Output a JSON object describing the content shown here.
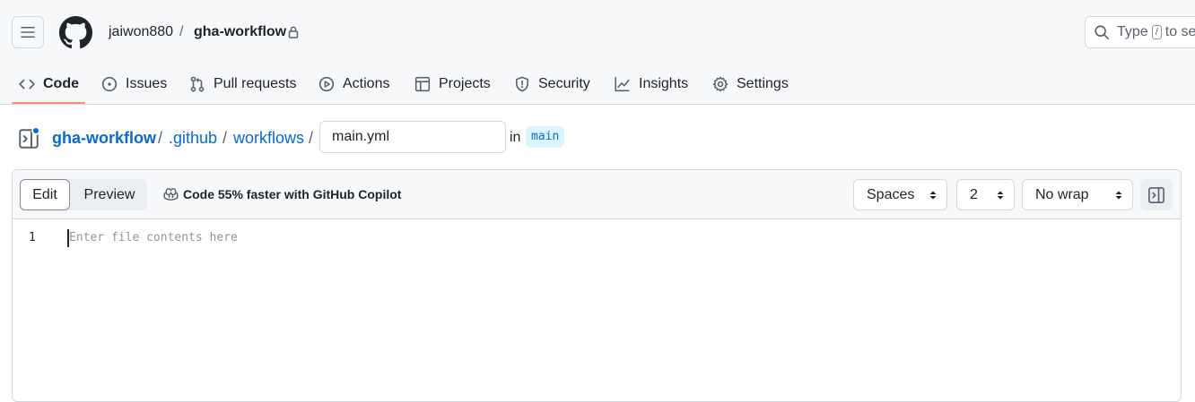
{
  "header": {
    "owner": "jaiwon880",
    "separator": "/",
    "repo": "gha-workflow",
    "search_prefix": "Type",
    "search_key": "/",
    "search_suffix": "to se"
  },
  "nav": {
    "tabs": [
      {
        "label": "Code",
        "icon": "code-icon",
        "selected": true
      },
      {
        "label": "Issues",
        "icon": "issue-icon"
      },
      {
        "label": "Pull requests",
        "icon": "pull-request-icon"
      },
      {
        "label": "Actions",
        "icon": "play-icon"
      },
      {
        "label": "Projects",
        "icon": "table-icon"
      },
      {
        "label": "Security",
        "icon": "shield-icon"
      },
      {
        "label": "Insights",
        "icon": "graph-icon"
      },
      {
        "label": "Settings",
        "icon": "gear-icon"
      }
    ]
  },
  "path": {
    "repo": "gha-workflow",
    "dir1": ".github",
    "dir2": "workflows",
    "sep": "/",
    "filename": "main.yml",
    "in_label": "in",
    "branch": "main"
  },
  "editor": {
    "edit_tab": "Edit",
    "preview_tab": "Preview",
    "copilot_text": "Code 55% faster with GitHub Copilot",
    "indent_mode": "Spaces",
    "indent_size": "2",
    "wrap_mode": "No wrap",
    "line_number": "1",
    "placeholder": "Enter file contents here"
  },
  "colors": {
    "accent": "#0969da",
    "tab_underline": "#fd8c73",
    "header_bg": "#f6f8fa"
  }
}
